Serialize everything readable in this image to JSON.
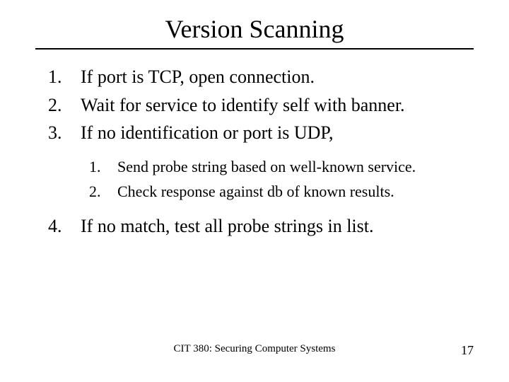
{
  "title": "Version Scanning",
  "items": [
    {
      "num": "1.",
      "text": "If port is TCP, open connection."
    },
    {
      "num": "2.",
      "text": "Wait for service to identify self with banner."
    },
    {
      "num": "3.",
      "text": "If no identification or port is UDP,"
    }
  ],
  "subitems": [
    {
      "num": "1.",
      "text": "Send probe string based on well-known service."
    },
    {
      "num": "2.",
      "text": "Check response against db of known results."
    }
  ],
  "item4": {
    "num": "4.",
    "text": "If no match, test all probe strings in list."
  },
  "footer": {
    "center": "CIT 380: Securing Computer Systems",
    "page": "17"
  }
}
